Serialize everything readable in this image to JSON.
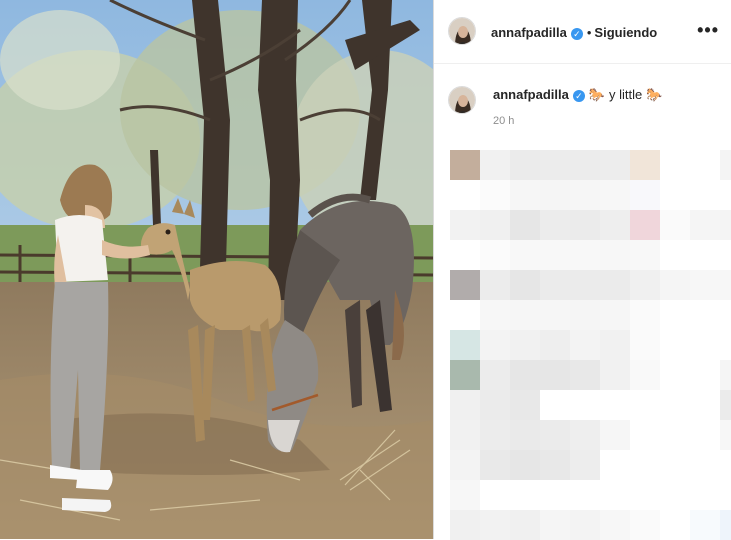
{
  "post": {
    "username": "annafpadilla",
    "follow_status": "Siguiendo",
    "separator": "•",
    "more_icon_glyph": "•••",
    "verified_glyph": "✓"
  },
  "caption": {
    "username": "annafpadilla",
    "text": "y little",
    "emoji_left": "🐎",
    "emoji_right": "🐎",
    "timestamp": "20 h"
  },
  "comments": {
    "note": "",
    "pixel_rows": [
      [
        "#c3ae9c",
        "#f1f1f1",
        "#ebebeb",
        "#ececec",
        "#ececec",
        "#ededed",
        "#f1e5d9",
        "#ffffff",
        "#ffffff",
        "#f4f4f4"
      ],
      [
        "#ffffff",
        "#fbfbfb",
        "#f6f6f6",
        "#f5f5f5",
        "#f6f6f6",
        "#f7f7f7",
        "#f8f8fb",
        "#ffffff",
        "#ffffff",
        "#ffffff"
      ],
      [
        "#f2f2f2",
        "#f0f0f0",
        "#e6e6e6",
        "#ececec",
        "#ebebeb",
        "#eeeeee",
        "#f0d6db",
        "#fafafa",
        "#f5f5f5",
        "#f4f4f4"
      ],
      [
        "#ffffff",
        "#fbfbfb",
        "#f8f8f8",
        "#f8f8f8",
        "#f8f8f8",
        "#f7f7f7",
        "#f8f8f8",
        "#ffffff",
        "#ffffff",
        "#ffffff"
      ],
      [
        "#b1acab",
        "#ececec",
        "#e6e6e6",
        "#ebebeb",
        "#ebebeb",
        "#ebebeb",
        "#f0f0f0",
        "#f5f5f5",
        "#f7f7f7",
        "#f7f7f7"
      ],
      [
        "#ffffff",
        "#f7f7f7",
        "#f6f6f6",
        "#f6f6f6",
        "#f5f5f5",
        "#f6f6f6",
        "#fafafa",
        "#ffffff",
        "#ffffff",
        "#ffffff"
      ],
      [
        "#d6e6e4",
        "#f3f3f3",
        "#f1f1f1",
        "#eeeeee",
        "#f3f3f3",
        "#f1f1f1",
        "#fafafa",
        "#ffffff",
        "#ffffff",
        "#ffffff"
      ],
      [
        "#a9b9ad",
        "#ececec",
        "#e6e6e6",
        "#e6e6e6",
        "#e8e8e8",
        "#f1f1f1",
        "#f9f9f9",
        "#ffffff",
        "#ffffff",
        "#f5f5f5"
      ],
      [
        "#f0f0f0",
        "#ebebeb",
        "#e8e8e8",
        "#ffffff",
        "#ffffff",
        "#ffffff",
        "#ffffff",
        "#ffffff",
        "#ffffff",
        "#ebebeb"
      ],
      [
        "#f1f1f1",
        "#ececec",
        "#eaeaea",
        "#ebebeb",
        "#eeeeee",
        "#f6f6f6",
        "#ffffff",
        "#ffffff",
        "#ffffff",
        "#f7f7f7"
      ],
      [
        "#f3f3f3",
        "#e9e9e9",
        "#e6e6e6",
        "#e8e8e8",
        "#ededed",
        "#ffffff",
        "#ffffff",
        "#ffffff",
        "#ffffff",
        "#ffffff"
      ],
      [
        "#f7f7f7",
        "#ffffff",
        "#ffffff",
        "#ffffff",
        "#ffffff",
        "#ffffff",
        "#ffffff",
        "#ffffff",
        "#ffffff",
        "#ffffff"
      ],
      [
        "#f0f0f0",
        "#f2f2f2",
        "#f0f0f0",
        "#f5f5f5",
        "#f3f3f3",
        "#f7f7f7",
        "#fafafa",
        "#ffffff",
        "#f7fafd",
        "#eef4fb"
      ]
    ]
  },
  "colors": {
    "verified": "#3897f0",
    "text": "#262626",
    "muted": "#8e8e8e",
    "border": "#dbdbdb"
  }
}
